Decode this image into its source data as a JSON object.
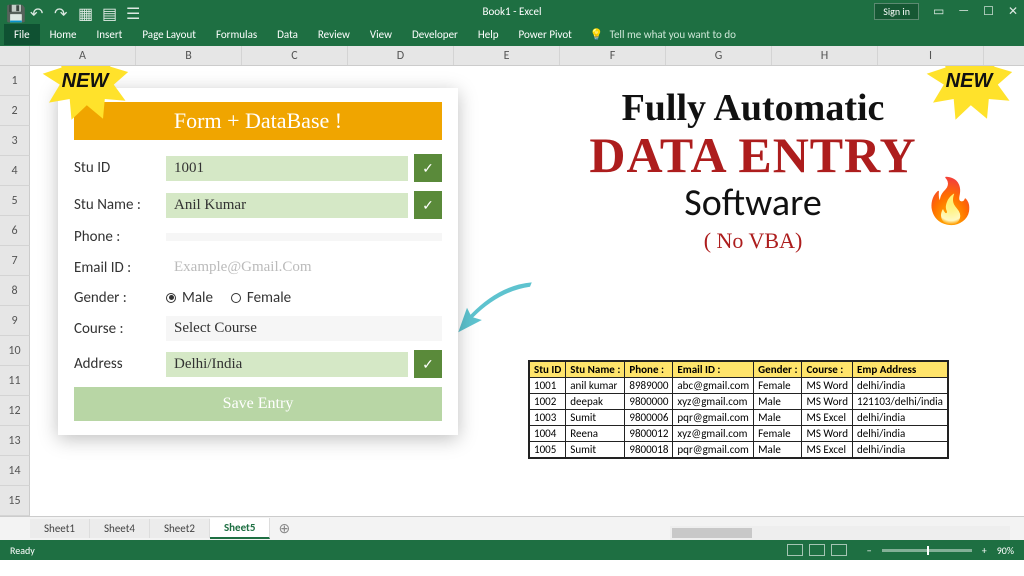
{
  "titlebar": {
    "doc": "Book1 - Excel",
    "signin": "Sign in"
  },
  "menu": [
    "File",
    "Home",
    "Insert",
    "Page Layout",
    "Formulas",
    "Data",
    "Review",
    "View",
    "Developer",
    "Help",
    "Power Pivot"
  ],
  "tellme": "Tell me what you want to do",
  "burst": "NEW",
  "columns": [
    "A",
    "B",
    "C",
    "D",
    "E",
    "F",
    "G",
    "H",
    "I"
  ],
  "rows": [
    "1",
    "2",
    "3",
    "4",
    "5",
    "6",
    "7",
    "8",
    "9",
    "10",
    "11",
    "12",
    "13",
    "14",
    "15"
  ],
  "form": {
    "title": "Form + DataBase !",
    "labels": {
      "id": "Stu ID",
      "name": "Stu Name :",
      "phone": "Phone :",
      "email": "Email ID :",
      "gender": "Gender :",
      "course": "Course :",
      "address": "Address"
    },
    "values": {
      "id": "1001",
      "name": "Anil Kumar",
      "phone": "",
      "email_placeholder": "Example@Gmail.Com",
      "course": "Select Course",
      "address": "Delhi/India"
    },
    "gender": {
      "male": "Male",
      "female": "Female",
      "selected": "male"
    },
    "save": "Save Entry"
  },
  "headline": {
    "l1": "Fully Automatic",
    "l2": "DATA ENTRY",
    "l3": "Software",
    "l4": "( No VBA)"
  },
  "table": {
    "headers": [
      "Stu ID",
      "Stu Name :",
      "Phone :",
      "Email ID :",
      "Gender :",
      "Course :",
      "Emp Address"
    ],
    "rows": [
      [
        "1001",
        "anil kumar",
        "8989000",
        "abc@gmail.com",
        "Female",
        "MS Word",
        "delhi/india"
      ],
      [
        "1002",
        "deepak",
        "9800000",
        "xyz@gmail.com",
        "Male",
        "MS Word",
        "121103/delhi/india"
      ],
      [
        "1003",
        "Sumit",
        "9800006",
        "pqr@gmail.com",
        "Male",
        "MS Excel",
        "delhi/india"
      ],
      [
        "1004",
        "Reena",
        "9800012",
        "xyz@gmail.com",
        "Female",
        "MS Word",
        "delhi/india"
      ],
      [
        "1005",
        "Sumit",
        "9800018",
        "pqr@gmail.com",
        "Male",
        "MS Excel",
        "delhi/india"
      ]
    ]
  },
  "sheets": [
    "Sheet1",
    "Sheet4",
    "Sheet2",
    "Sheet5"
  ],
  "activeSheet": "Sheet5",
  "status": {
    "ready": "Ready",
    "zoom": "90%"
  }
}
